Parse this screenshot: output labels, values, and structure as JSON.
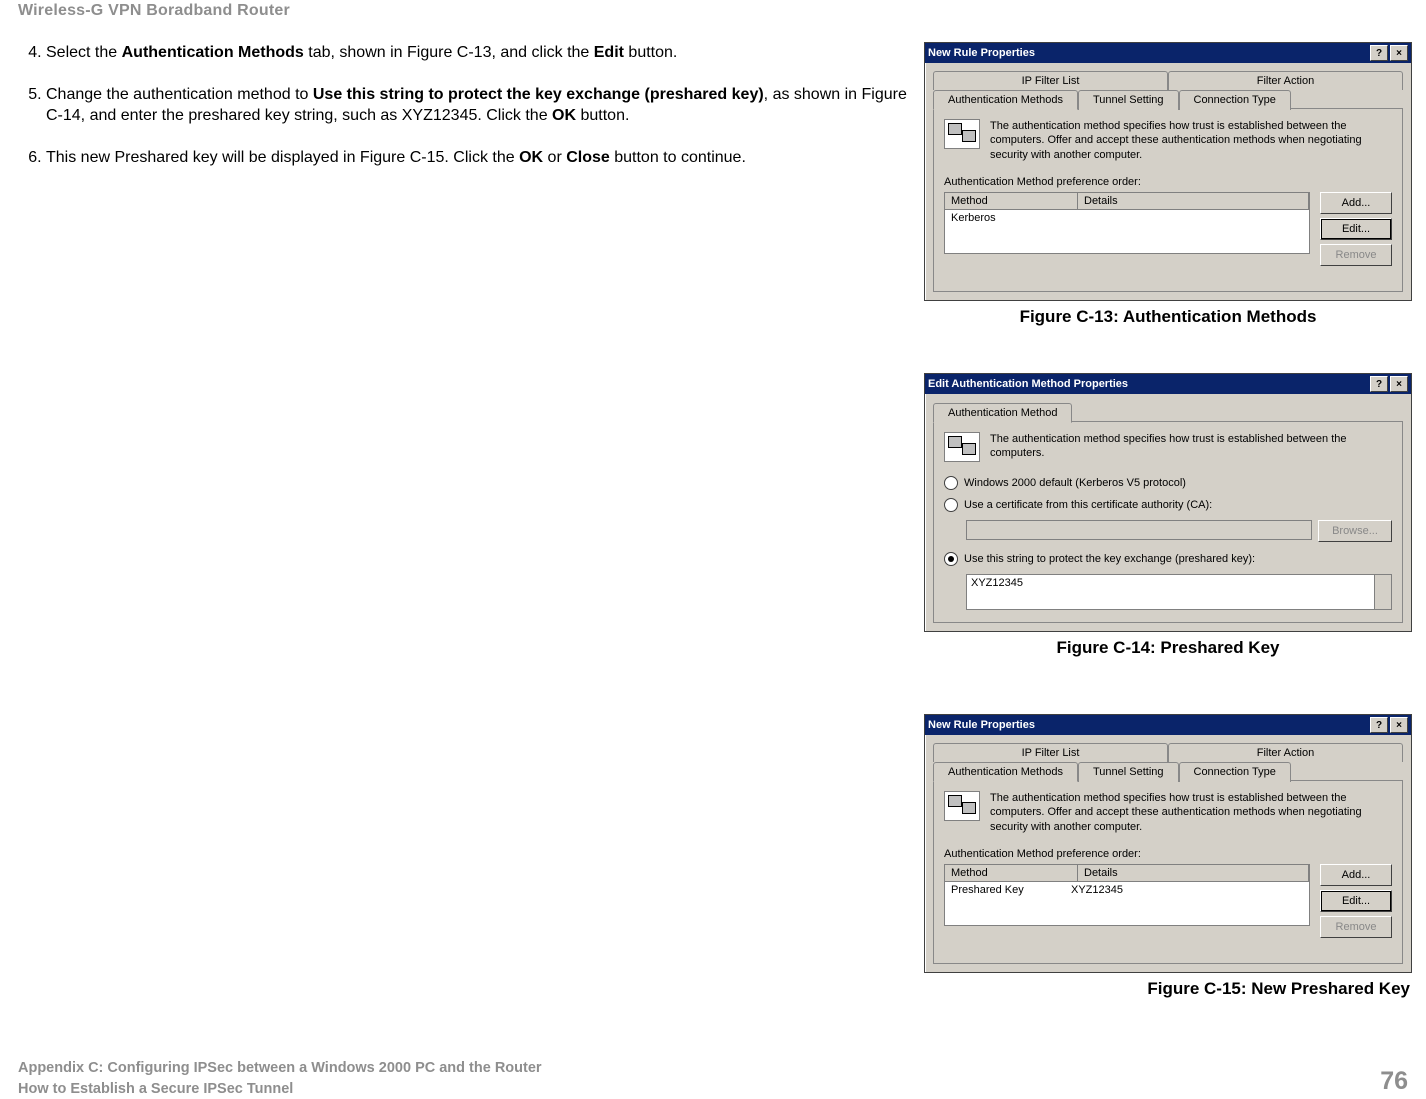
{
  "header": {
    "product": "Wireless-G VPN Boradband Router"
  },
  "steps": {
    "s4": {
      "pre": "Select the ",
      "b1": "Authentication Methods",
      "mid": " tab, shown in Figure C-13, and click the ",
      "b2": "Edit",
      "post": " button."
    },
    "s5": {
      "pre": "Change the authentication method to ",
      "b1": "Use this string to protect the key exchange (preshared key)",
      "mid": ", as shown in Figure C-14, and enter the preshared key string, such as XYZ12345. Click the ",
      "b2": "OK",
      "post": " button."
    },
    "s6": {
      "pre": "This new Preshared key will be displayed in Figure C-15. Click the ",
      "b1": "OK",
      "mid": " or ",
      "b2": "Close",
      "post": " button to continue."
    }
  },
  "fig13": {
    "title": "New Rule Properties",
    "tabs": {
      "t1": "IP Filter List",
      "t2": "Filter Action",
      "t3": "Authentication Methods",
      "t4": "Tunnel Setting",
      "t5": "Connection Type"
    },
    "desc": "The authentication method specifies how trust is established between the computers. Offer and accept these authentication methods when negotiating security with another computer.",
    "listLabel": "Authentication Method preference order:",
    "col1": "Method",
    "col2": "Details",
    "row1": "Kerberos",
    "btnAdd": "Add...",
    "btnEdit": "Edit...",
    "btnRemove": "Remove",
    "caption": "Figure C-13: Authentication Methods"
  },
  "fig14": {
    "title": "Edit Authentication Method Properties",
    "tab": "Authentication Method",
    "desc": "The authentication method specifies how trust is established between the computers.",
    "r1": "Windows 2000 default (Kerberos V5 protocol)",
    "r2": "Use a certificate from this certificate authority (CA):",
    "r3": "Use this string to protect the key exchange (preshared key):",
    "browse": "Browse...",
    "key": "XYZ12345",
    "caption": "Figure C-14: Preshared Key"
  },
  "fig15": {
    "title": "New Rule Properties",
    "desc": "The authentication method specifies how trust is established between the computers. Offer and accept these authentication methods when negotiating security with another computer.",
    "row_method": "Preshared Key",
    "row_details": "XYZ12345",
    "caption": "Figure C-15: New Preshared Key"
  },
  "footer": {
    "line1": "Appendix C: Configuring IPSec between a Windows 2000 PC and the Router",
    "line2": "How to Establish a Secure IPSec Tunnel",
    "page": "76"
  }
}
